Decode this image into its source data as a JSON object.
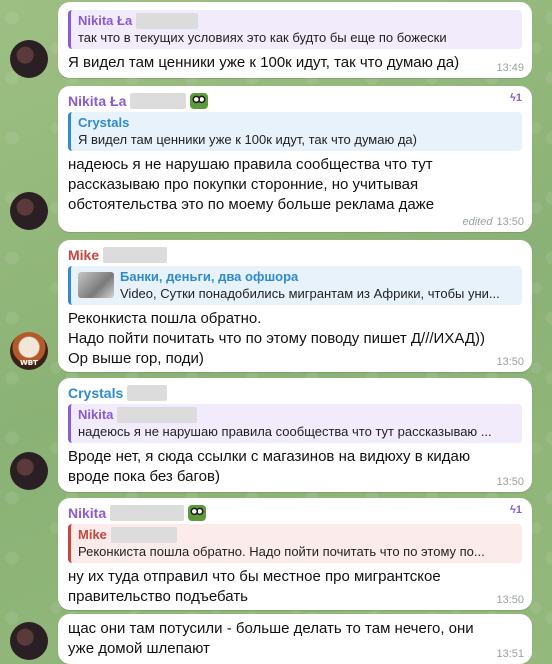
{
  "colors": {
    "purple": "#8a5bd4",
    "blue": "#2f8ad0",
    "red": "#c7463c",
    "time": "#9aa39a"
  },
  "messages": [
    {
      "reply_name": "Nikita Ła",
      "reply_text": "так что в текущих условиях это как будто бы еще по божески",
      "text": "Я видел там ценники уже к 100к идут, так что думаю да)",
      "time": "13:49"
    },
    {
      "sender": "Nikita Ła",
      "boost": "1",
      "reply_name": "Crystals",
      "reply_text": "Я видел там ценники уже к 100к идут, так что думаю да)",
      "text": "надеюсь я не нарушаю правила сообщества что тут рассказываю про покупки сторонние, но учитывая обстоятельства это по моему больше реклама даже",
      "edited": "edited",
      "time": "13:50"
    },
    {
      "sender": "Mike",
      "reply_name": "Банки, деньги, два офшора",
      "reply_text": "Video, Сутки понадобились мигрантам из Африки, чтобы уни...",
      "text_lines": [
        "Реконкиста пошла обратно.",
        "Надо пойти почитать что по этому поводу пишет Д///ИХАД))",
        "Ор выше гор, поди)"
      ],
      "time": "13:50"
    },
    {
      "sender": "Crystals",
      "reply_name": "Nikita",
      "reply_text": "надеюсь я не нарушаю правила сообщества что тут рассказываю ...",
      "text": "Вроде нет, я сюда ссылки с магазинов на видюху в кидаю вроде пока без багов)",
      "time": "13:50"
    },
    {
      "sender": "Nikita",
      "boost": "1",
      "reply_name": "Mike",
      "reply_text": "Реконкиста пошла обратно. Надо пойти почитать что по этому по...",
      "text": "ну их туда отправил что бы местное про мигрантское правительство подъебать",
      "time": "13:50"
    },
    {
      "text": "щас они там потусили - больше делать то там нечего, они уже домой шлепают",
      "time": "13:51"
    }
  ]
}
